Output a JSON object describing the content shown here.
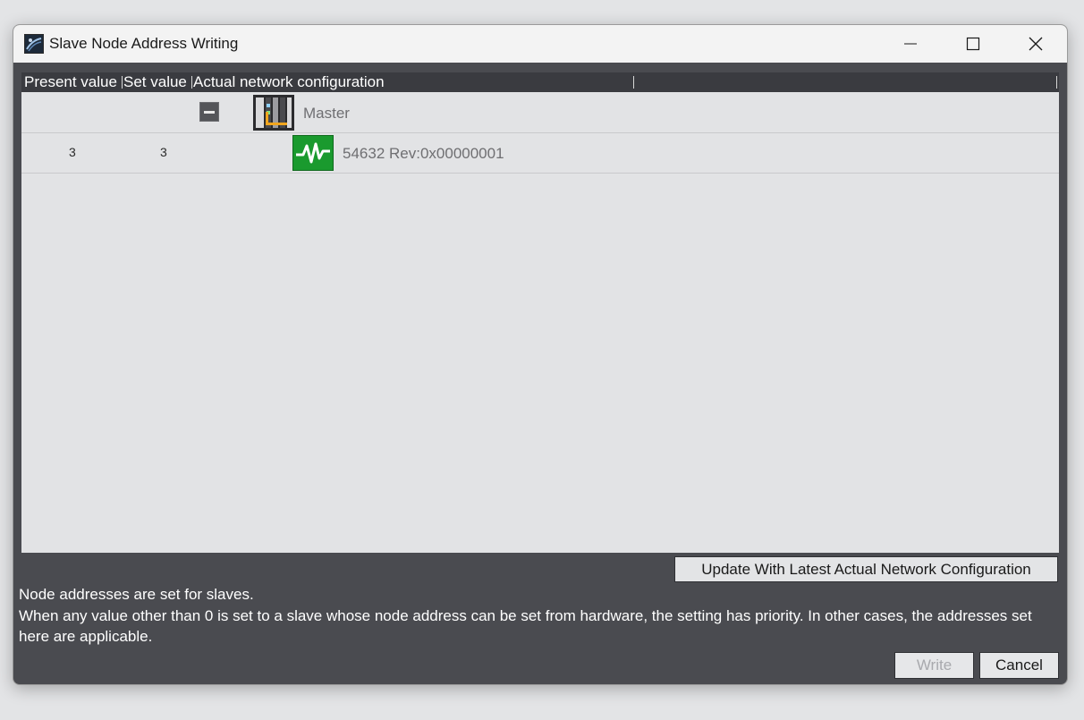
{
  "window": {
    "title": "Slave Node Address Writing",
    "icon": "app-icon"
  },
  "grid": {
    "columns": [
      "Present value",
      "Set value",
      "Actual network configuration"
    ],
    "rows": [
      {
        "present": "",
        "set": "",
        "device": "Master",
        "icon": "master-controller-icon"
      },
      {
        "present": "3",
        "set": "3",
        "device": "54632 Rev:0x00000001",
        "icon": "slave-device-icon"
      }
    ]
  },
  "buttons": {
    "update": "Update With Latest Actual Network Configuration",
    "write": "Write",
    "cancel": "Cancel"
  },
  "info": {
    "line1": "Node addresses are set for slaves.",
    "line2": "When any value other than 0 is set to a slave whose node address can be set from hardware, the setting has priority. In other cases, the addresses set here are applicable."
  },
  "colors": {
    "dialog_bg": "#4a4b50",
    "grid_bg": "#e2e3e5",
    "header_bg": "#3a3b40",
    "connector": "#f0a51e",
    "slave_icon": "#1a9a2e"
  }
}
